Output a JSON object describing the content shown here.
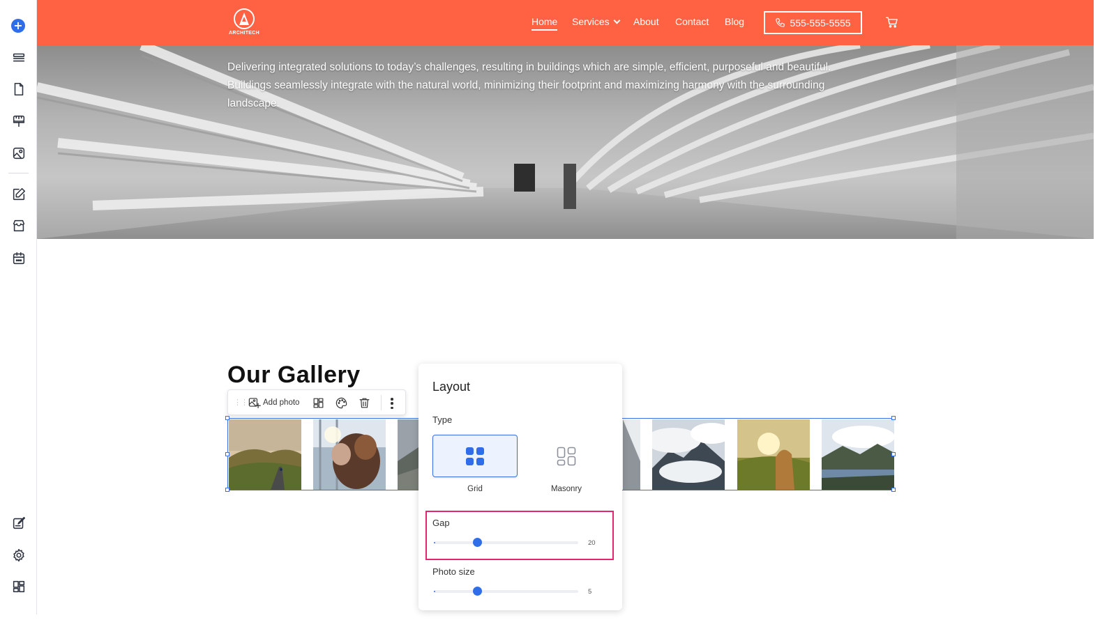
{
  "editor_sidebar": {
    "items": [
      "add-icon",
      "sections-icon",
      "pages-icon",
      "theme-icon",
      "media-icon",
      "blog-editor-icon",
      "store-icon",
      "calendar-icon",
      "forms-icon",
      "settings-icon",
      "apps-icon"
    ]
  },
  "header": {
    "logo_text": "ARCHITECH",
    "nav": [
      {
        "label": "Home",
        "active": true
      },
      {
        "label": "Services",
        "has_dropdown": true
      },
      {
        "label": "About"
      },
      {
        "label": "Contact"
      },
      {
        "label": "Blog"
      }
    ],
    "phone": "555-555-5555",
    "brand_color": "#ff6243"
  },
  "hero": {
    "line1": "Delivering integrated solutions to today’s challenges, resulting in buildings which are simple, efficient, purposeful and beautiful.",
    "line2": "Buildings seamlessly integrate with the natural world, minimizing their footprint and maximizing harmony with the surrounding",
    "line3": "landscape."
  },
  "gallery": {
    "title": "Our Gallery",
    "toolbar": {
      "add_photo_label": "Add photo",
      "icons": [
        "drag-handle-icon",
        "add-photo-icon",
        "layout-icon",
        "palette-icon",
        "trash-icon",
        "more-icon"
      ]
    },
    "photos": [
      "road-mountains-photo",
      "couple-hug-photo",
      "partial-photo",
      "partial-photo-right",
      "cloudy-mountain-photo",
      "woman-sunset-photo",
      "lake-mountains-photo"
    ]
  },
  "layout_panel": {
    "title": "Layout",
    "type_label": "Type",
    "types": [
      {
        "label": "Grid",
        "selected": true
      },
      {
        "label": "Masonry",
        "selected": false
      }
    ],
    "gap": {
      "label": "Gap",
      "value": "20",
      "fraction": 0.3
    },
    "photo_size": {
      "label": "Photo size",
      "value": "5",
      "fraction": 0.3
    },
    "accent_color": "#2f6ee8",
    "highlight_color": "#e6246f"
  }
}
